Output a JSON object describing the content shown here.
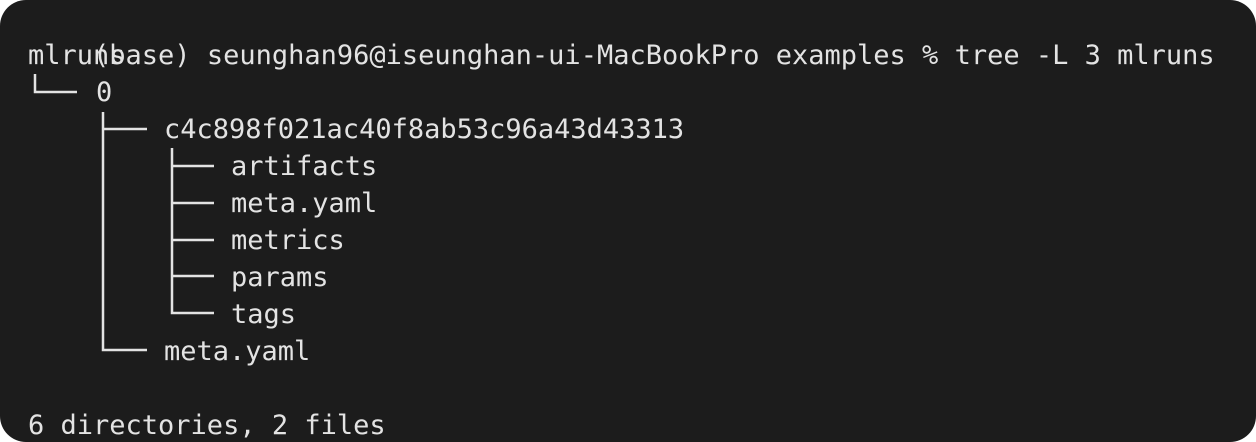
{
  "terminal": {
    "prompt": "(base) seunghan96@iseunghan-ui-MacBookPro examples % ",
    "command": "tree -L 3 mlruns",
    "tree": {
      "root": "mlruns",
      "experiment": "0",
      "run": "c4c898f021ac40f8ab53c96a43d43313",
      "run_children": [
        "artifacts",
        "meta.yaml",
        "metrics",
        "params",
        "tags"
      ],
      "experiment_meta": "meta.yaml"
    },
    "summary": "6 directories, 2 files"
  },
  "colors": {
    "background": "#1c1c1c",
    "text": "#e3e3e3"
  }
}
